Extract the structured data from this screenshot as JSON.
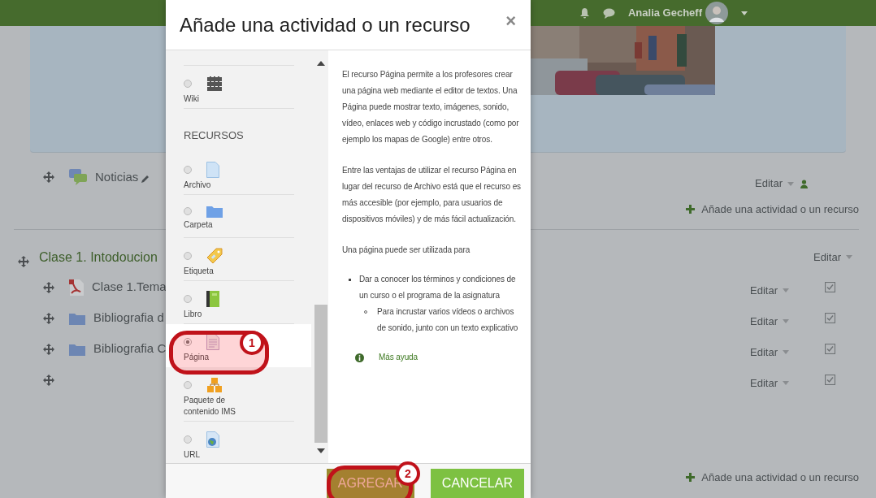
{
  "top_bar": {
    "user_name": "Analia Gecheff"
  },
  "sections": [
    {
      "items": [
        {
          "kind": "forum",
          "name": "Noticias",
          "edit": "Editar"
        }
      ],
      "add_link": "Añade una actividad o un recurso"
    },
    {
      "title": "Clase 1. Intodoucion",
      "edit": "Editar",
      "items": [
        {
          "kind": "pdf",
          "name": "Clase 1.Tema",
          "edit": "Editar",
          "done": true
        },
        {
          "kind": "folder",
          "name": "Bibliografia d",
          "edit": "Editar",
          "done": true
        },
        {
          "kind": "folder",
          "name": "Bibliografia C",
          "edit": "Editar",
          "done": true
        },
        {
          "kind": "label",
          "edit": "Editar",
          "done": true
        }
      ],
      "add_link": "Añade una actividad o un recurso"
    }
  ],
  "modal": {
    "title": "Añade una actividad o un recurso",
    "close": "×",
    "options": [
      {
        "kind": "wiki",
        "label": "Wiki",
        "selected": false
      },
      {
        "kind": "heading",
        "label": "RECURSOS"
      },
      {
        "kind": "file",
        "label": "Archivo",
        "selected": false
      },
      {
        "kind": "folder",
        "label": "Carpeta",
        "selected": false
      },
      {
        "kind": "tag",
        "label": "Etiqueta",
        "selected": false
      },
      {
        "kind": "book",
        "label": "Libro",
        "selected": false
      },
      {
        "kind": "page",
        "label": "Página",
        "selected": true
      },
      {
        "kind": "package",
        "label": "Paquete de contenido IMS",
        "selected": false
      },
      {
        "kind": "url",
        "label": "URL",
        "selected": false
      }
    ],
    "description": [
      {
        "kind": "paragraph",
        "text": "El recurso Página permite a los profesores crear una página web mediante el editor de textos. Una Página puede mostrar texto, imágenes, sonido, vídeo, enlaces web y código incrustado (como por ejemplo los mapas de Google) entre otros."
      },
      {
        "kind": "paragraph",
        "text": "Entre las ventajas de utilizar el recurso Página en lugar del recurso de Archivo está que el recurso es más accesible (por ejemplo, para usuarios de dispositivos móviles) y de más fácil actualización."
      },
      {
        "kind": "paragraph",
        "text": "Una página puede ser utilizada para"
      },
      {
        "kind": "list",
        "items": [
          {
            "text": "Dar a conocer los términos y condiciones de un curso o el programa de la asignatura",
            "children": [
              {
                "text": "Para incrustar varios vídeos o archivos de sonido, junto con un texto explicativo"
              }
            ]
          }
        ]
      }
    ],
    "help_link": "Más ayuda",
    "buttons": [
      {
        "kind": "primary",
        "label": "AGREGAR"
      },
      {
        "kind": "secondary",
        "label": "CANCELAR"
      }
    ]
  },
  "annotations": [
    {
      "number": "1"
    },
    {
      "number": "2"
    }
  ]
}
